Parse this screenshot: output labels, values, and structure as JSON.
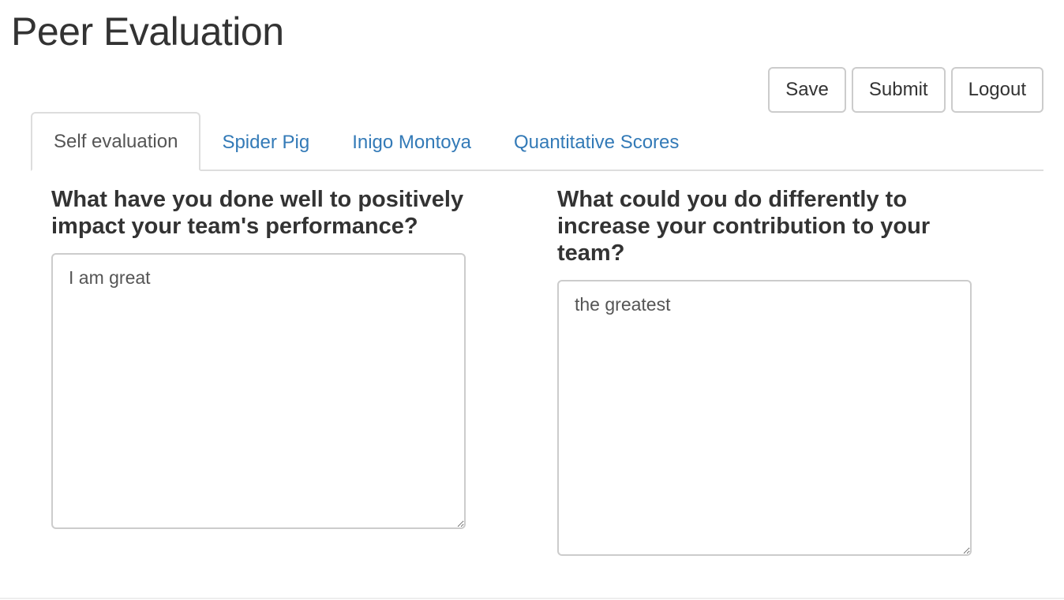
{
  "page": {
    "title": "Peer Evaluation"
  },
  "actions": {
    "save_label": "Save",
    "submit_label": "Submit",
    "logout_label": "Logout"
  },
  "tabs": [
    {
      "label": "Self evaluation",
      "active": true
    },
    {
      "label": "Spider Pig",
      "active": false
    },
    {
      "label": "Inigo Montoya",
      "active": false
    },
    {
      "label": "Quantitative Scores",
      "active": false
    }
  ],
  "questions": [
    {
      "prompt": "What have you done well to positively impact your team's performance?",
      "answer": "I am great"
    },
    {
      "prompt": "What could you do differently to increase your contribution to your team?",
      "answer": "the greatest"
    }
  ],
  "colors": {
    "link": "#337ab7",
    "text": "#333333",
    "border": "#cccccc"
  }
}
